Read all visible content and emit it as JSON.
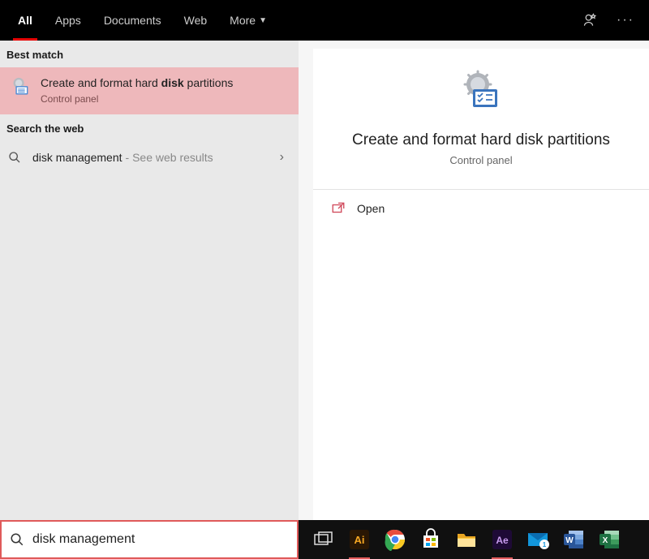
{
  "tabs": {
    "items": [
      {
        "label": "All",
        "active": true
      },
      {
        "label": "Apps",
        "active": false
      },
      {
        "label": "Documents",
        "active": false
      },
      {
        "label": "Web",
        "active": false
      },
      {
        "label": "More",
        "active": false,
        "hasDropdown": true
      }
    ]
  },
  "sections": {
    "bestMatch": "Best match",
    "searchWeb": "Search the web"
  },
  "bestMatch": {
    "titlePre": "Create and format hard ",
    "titleBold": "disk",
    "titlePost": " partitions",
    "subtitle": "Control panel"
  },
  "webSearch": {
    "query": "disk management",
    "hint": " - See web results"
  },
  "preview": {
    "title": "Create and format hard disk partitions",
    "subtitle": "Control panel",
    "action": "Open"
  },
  "search": {
    "value": "disk management"
  },
  "taskbar": {
    "items": [
      {
        "name": "task-view-icon"
      },
      {
        "name": "illustrator-icon"
      },
      {
        "name": "chrome-icon"
      },
      {
        "name": "store-icon"
      },
      {
        "name": "file-explorer-icon"
      },
      {
        "name": "after-effects-icon"
      },
      {
        "name": "mail-icon"
      },
      {
        "name": "word-icon"
      },
      {
        "name": "excel-icon"
      }
    ]
  }
}
